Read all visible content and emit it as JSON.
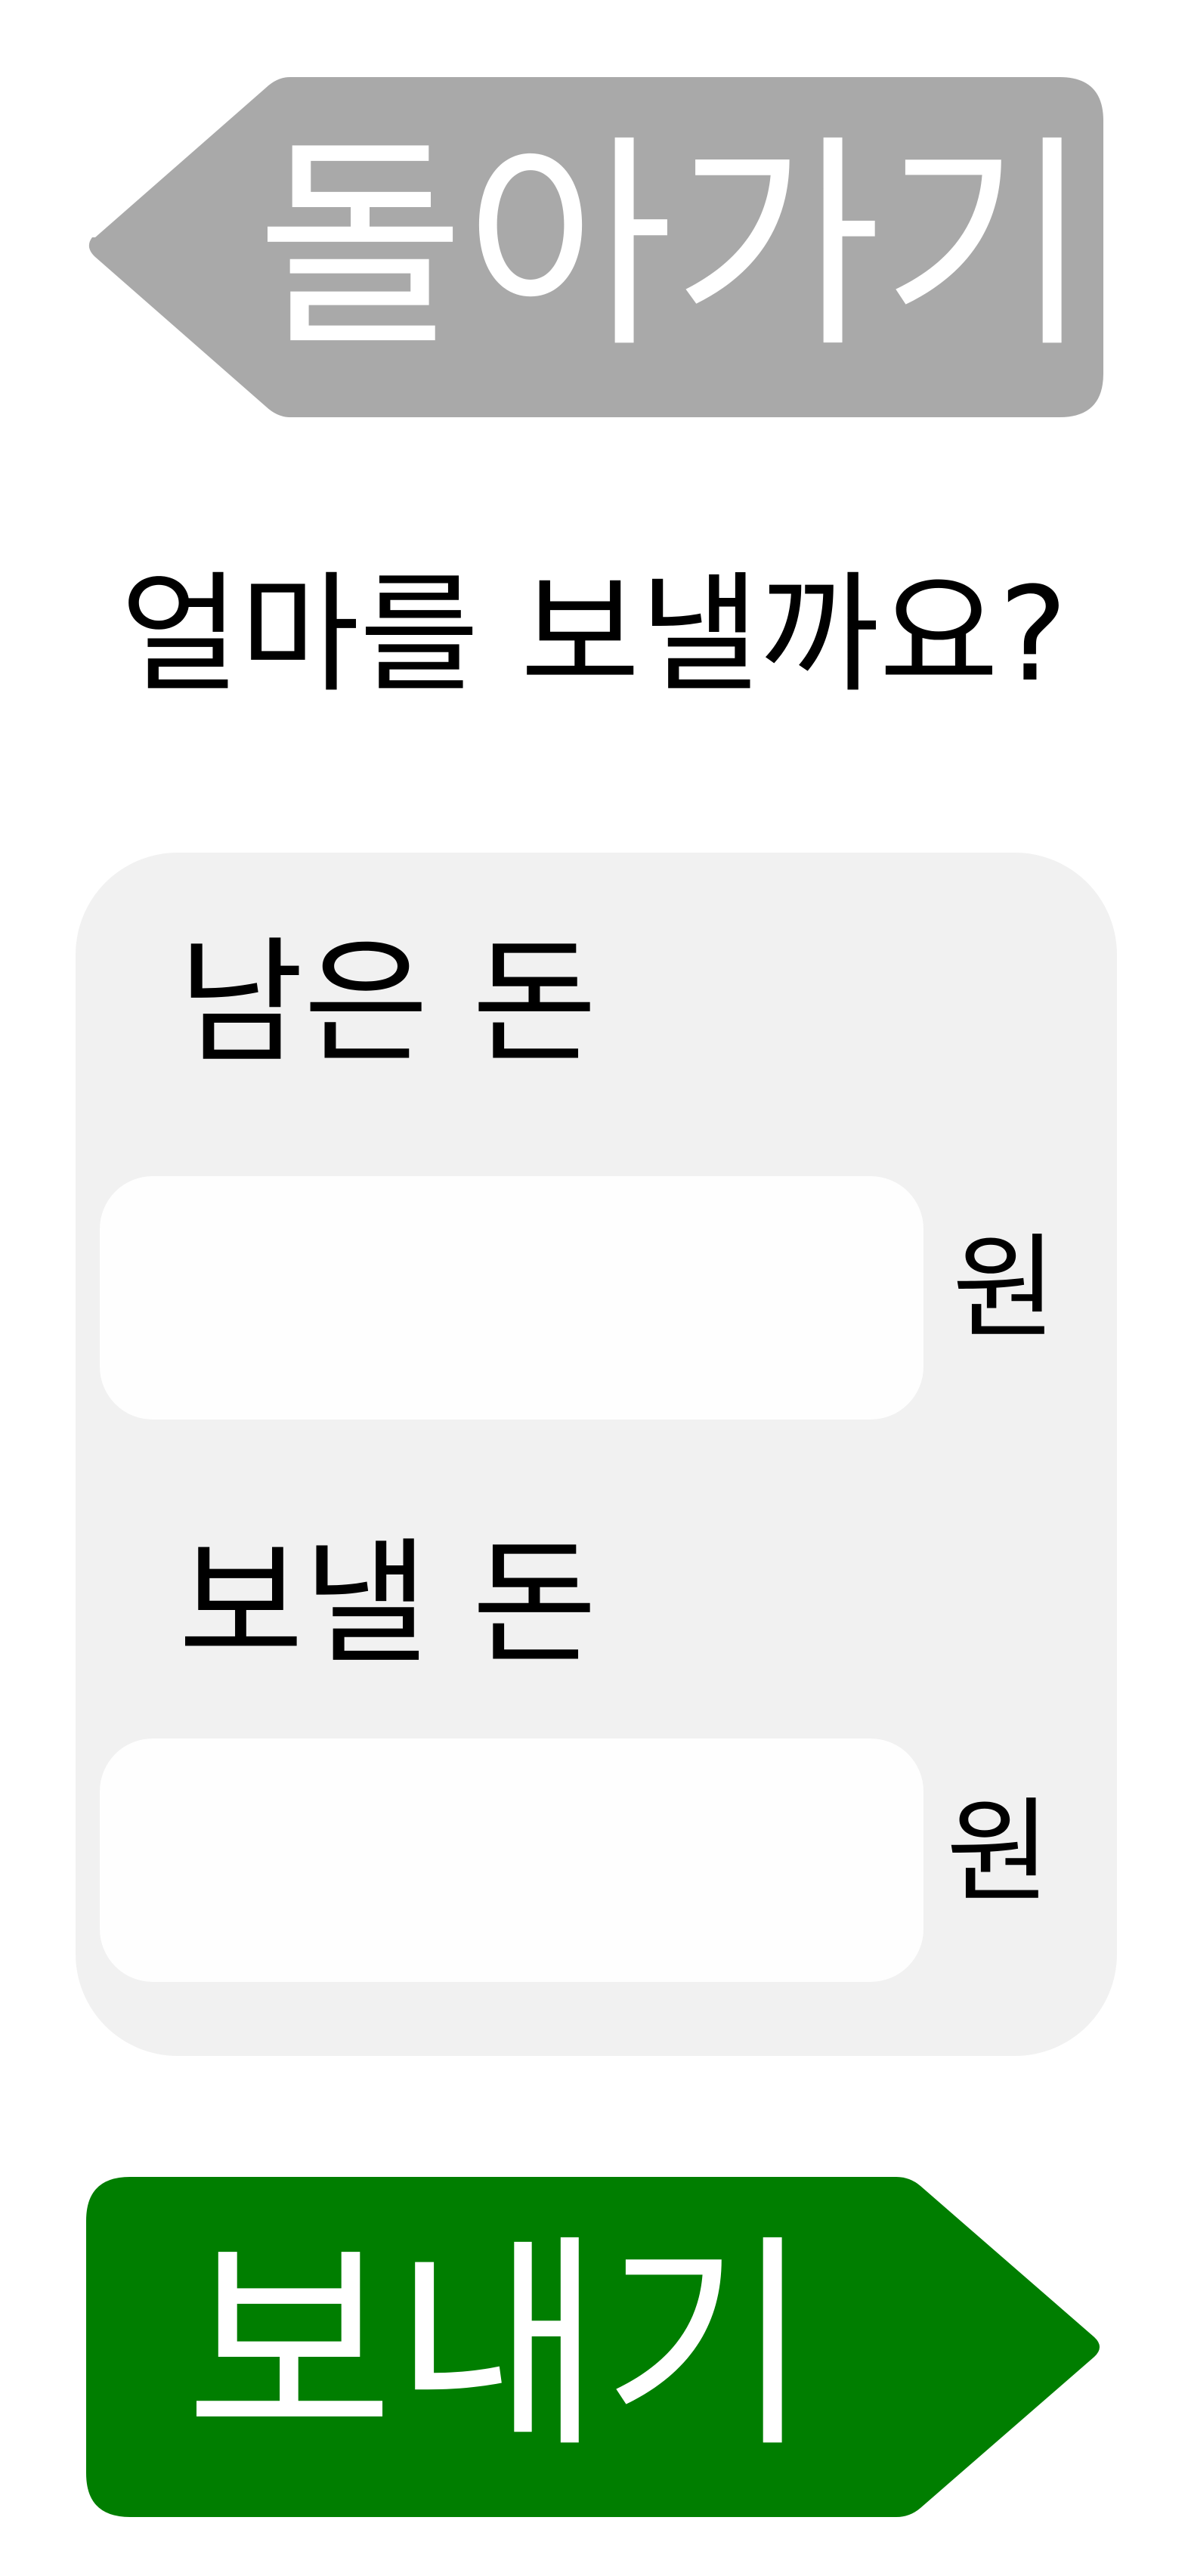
{
  "back_button": {
    "label": "돌아가기",
    "color": "#a9a9a9"
  },
  "question": {
    "text": "얼마를 보낼까요?"
  },
  "form": {
    "panel_color": "#f1f1f1",
    "remaining": {
      "label": "남은 돈",
      "value": "",
      "unit": "원"
    },
    "send": {
      "label": "보낼 돈",
      "value": "",
      "unit": "원"
    }
  },
  "send_button": {
    "label": "보내기",
    "color": "#007e00"
  }
}
